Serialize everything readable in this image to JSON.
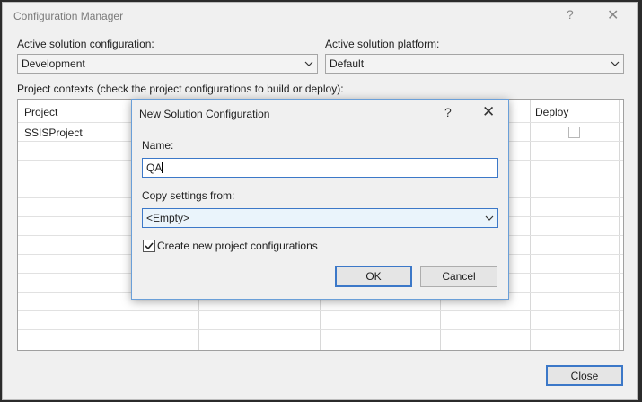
{
  "window": {
    "title": "Configuration Manager",
    "help_icon": "?",
    "close_icon": "✕"
  },
  "active_config": {
    "label": "Active solution configuration:",
    "value": "Development"
  },
  "active_platform": {
    "label": "Active solution platform:",
    "value": "Default"
  },
  "project_contexts": {
    "label": "Project contexts (check the project configurations to build or deploy):",
    "columns": [
      "Project",
      "Deploy"
    ],
    "rows": [
      {
        "project": "SSISProject",
        "deploy": false
      }
    ]
  },
  "close_button": {
    "label": "Close"
  },
  "dialog": {
    "title": "New Solution Configuration",
    "help_icon": "?",
    "close_icon": "✕",
    "name_label": "Name:",
    "name_value": "QA",
    "copy_label": "Copy settings from:",
    "copy_value": "<Empty>",
    "create_checkbox_label": "Create new project configurations",
    "create_checked": true,
    "ok_label": "OK",
    "cancel_label": "Cancel"
  },
  "icons": {
    "dropdown": "chevron-down-icon",
    "check": "checkmark-icon"
  },
  "colors": {
    "focus_border": "#3c78c8",
    "dialog_border": "#6a9fd8"
  }
}
